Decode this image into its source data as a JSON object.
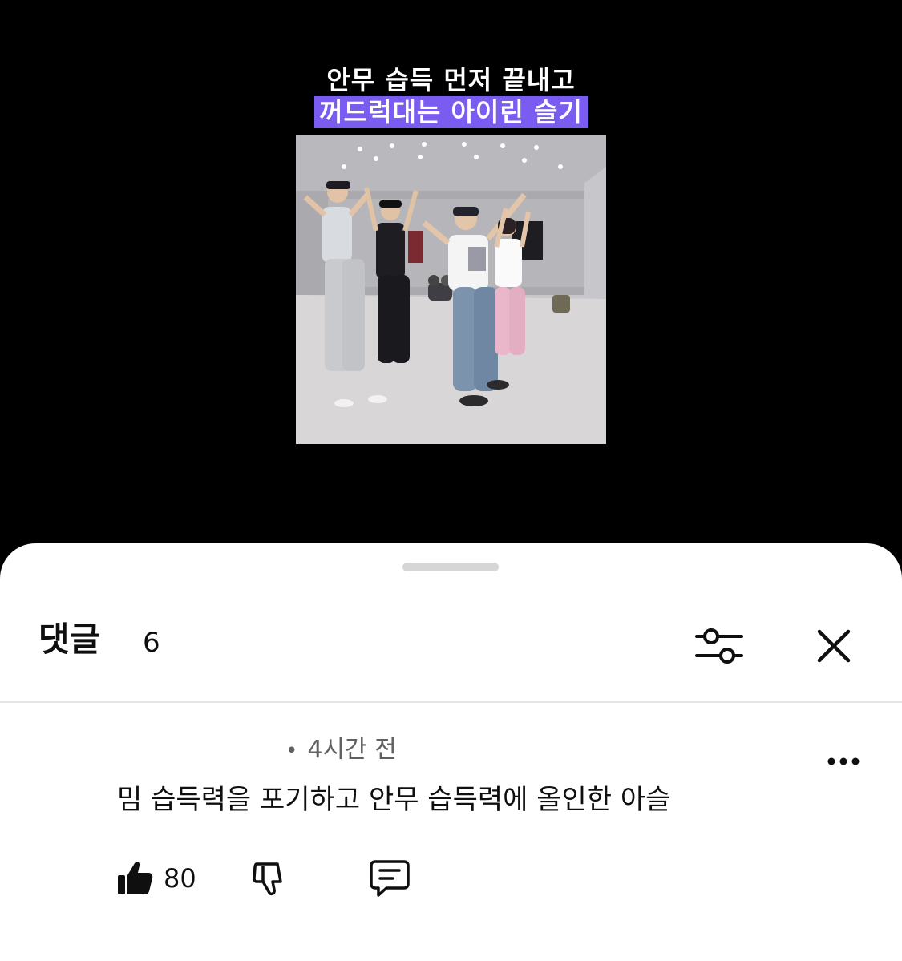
{
  "video": {
    "caption_line1": "안무 습득 먼저 끝내고",
    "caption_line2": "꺼드럭대는 아이린 슬기",
    "caption_highlight_color": "#7b5cf0"
  },
  "comments_sheet": {
    "title": "댓글",
    "count": "6",
    "sort_icon": "sliders-icon",
    "close_icon": "close-icon"
  },
  "comment": {
    "time": "4시간 전",
    "dot": "•",
    "text": "밈 습득력을 포기하고 안무 습득력에 올인한 아슬",
    "like_count": "80",
    "icons": {
      "like": "thumb-up-filled-icon",
      "dislike": "thumb-down-icon",
      "reply": "reply-bubble-icon",
      "more": "more-horizontal-icon"
    }
  }
}
